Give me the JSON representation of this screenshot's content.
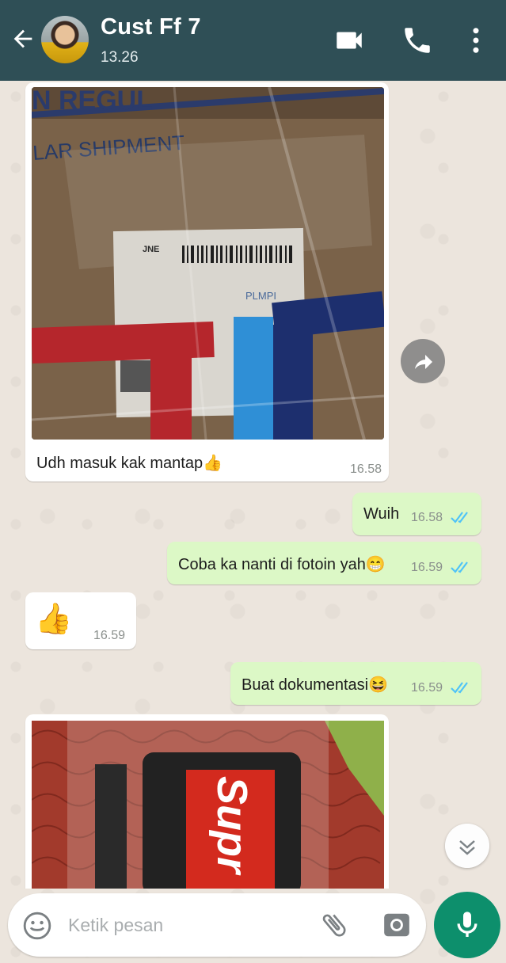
{
  "header": {
    "contact_name": "Cust Ff 7",
    "last_seen": "13.26",
    "icons": [
      "back-arrow-icon",
      "avatar",
      "video-call-icon",
      "phone-icon",
      "more-vert-icon"
    ]
  },
  "photo1": {
    "label_text": "LAR SHIPMENT",
    "top_text": "N REGUL",
    "sticker_brand": "JNE",
    "sticker_side_text": "PLMPI"
  },
  "photo2": {
    "brand_text": "Supr"
  },
  "messages": [
    {
      "id": "m1",
      "direction": "incoming",
      "type": "image",
      "caption": "Udh masuk kak mantap👍",
      "time": "16.58"
    },
    {
      "id": "m2",
      "direction": "outgoing",
      "type": "text",
      "text": "Wuih",
      "time": "16.58",
      "status": "read"
    },
    {
      "id": "m3",
      "direction": "outgoing",
      "type": "text",
      "text": "Coba ka nanti di fotoin yah😁",
      "time": "16.59",
      "status": "read"
    },
    {
      "id": "m4",
      "direction": "incoming",
      "type": "emoji",
      "text": "👍",
      "time": "16.59"
    },
    {
      "id": "m5",
      "direction": "outgoing",
      "type": "text",
      "text": "Buat dokumentasi😆",
      "time": "16.59",
      "status": "read"
    },
    {
      "id": "m6",
      "direction": "incoming",
      "type": "image",
      "caption": "",
      "time": ""
    }
  ],
  "input": {
    "placeholder": "Ketik pesan",
    "icons": [
      "emoji-icon",
      "attach-icon",
      "camera-icon",
      "mic-icon"
    ]
  },
  "colors": {
    "header_bg": "#2f4f56",
    "outgoing_bubble": "#dcf8c6",
    "incoming_bubble": "#ffffff",
    "chat_bg": "#ece5dd",
    "read_ticks": "#4fc3f7",
    "mic_button": "#0d8f6c"
  }
}
